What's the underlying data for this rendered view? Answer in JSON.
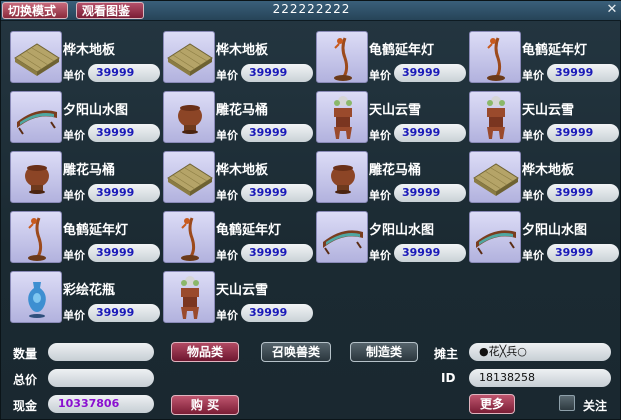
{
  "titlebar": {
    "mode_button": "切换模式",
    "gallery_button": "观看图鉴",
    "title": "222222222",
    "close": "✕"
  },
  "price_label": "单价",
  "items": [
    {
      "name": "桦木地板",
      "price": "39999",
      "icon": "floor-tile-icon"
    },
    {
      "name": "桦木地板",
      "price": "39999",
      "icon": "floor-tile-icon"
    },
    {
      "name": "龟鹤延年灯",
      "price": "39999",
      "icon": "crane-lamp-icon"
    },
    {
      "name": "龟鹤延年灯",
      "price": "39999",
      "icon": "crane-lamp-icon"
    },
    {
      "name": "夕阳山水图",
      "price": "39999",
      "icon": "landscape-screen-icon"
    },
    {
      "name": "雕花马桶",
      "price": "39999",
      "icon": "carved-pot-icon"
    },
    {
      "name": "天山云雪",
      "price": "39999",
      "icon": "flower-stand-icon"
    },
    {
      "name": "天山云雪",
      "price": "39999",
      "icon": "flower-stand-icon"
    },
    {
      "name": "雕花马桶",
      "price": "39999",
      "icon": "carved-pot-icon"
    },
    {
      "name": "桦木地板",
      "price": "39999",
      "icon": "floor-tile-icon"
    },
    {
      "name": "雕花马桶",
      "price": "39999",
      "icon": "carved-pot-icon"
    },
    {
      "name": "桦木地板",
      "price": "39999",
      "icon": "floor-tile-icon"
    },
    {
      "name": "龟鹤延年灯",
      "price": "39999",
      "icon": "crane-lamp-icon"
    },
    {
      "name": "龟鹤延年灯",
      "price": "39999",
      "icon": "crane-lamp-icon"
    },
    {
      "name": "夕阳山水图",
      "price": "39999",
      "icon": "landscape-screen-icon"
    },
    {
      "name": "夕阳山水图",
      "price": "39999",
      "icon": "landscape-screen-icon"
    },
    {
      "name": "彩绘花瓶",
      "price": "39999",
      "icon": "painted-vase-icon"
    },
    {
      "name": "天山云雪",
      "price": "39999",
      "icon": "flower-stand-icon"
    }
  ],
  "bottom": {
    "quantity_label": "数量",
    "quantity_value": "",
    "total_label": "总价",
    "total_value": "",
    "cash_label": "现金",
    "cash_value": "10337806",
    "cat_items": "物品类",
    "cat_summon": "召唤兽类",
    "cat_craft": "制造类",
    "buy_button": "购 买",
    "owner_label": "摊主",
    "owner_value": "●花╳兵○",
    "id_label": "ID",
    "id_value": "18138258",
    "more_button": "更多",
    "follow_label": "关注"
  }
}
